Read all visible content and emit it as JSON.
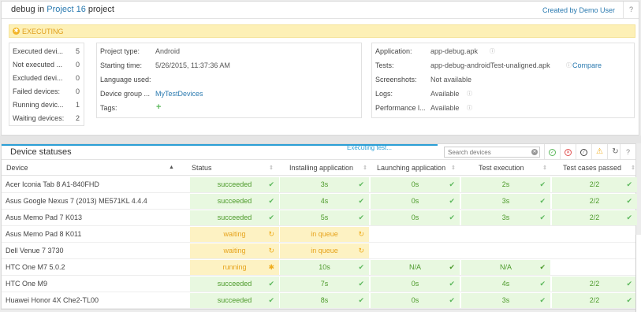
{
  "header": {
    "title_prefix": "debug",
    "title_in": "in",
    "project_link": "Project 16",
    "title_suffix": "project",
    "created_by": "Created by Demo User",
    "help": "?"
  },
  "status_banner": {
    "text": "EXECUTING",
    "color": "#fdf0b6"
  },
  "counts": [
    {
      "label": "Executed devi...",
      "value": "5"
    },
    {
      "label": "Not executed ...",
      "value": "0"
    },
    {
      "label": "Excluded devi...",
      "value": "0"
    },
    {
      "label": "Failed devices:",
      "value": "0"
    },
    {
      "label": "Running devic...",
      "value": "1"
    },
    {
      "label": "Waiting devices:",
      "value": "2"
    }
  ],
  "project_info": [
    {
      "label": "Project type:",
      "value": "Android"
    },
    {
      "label": "Starting time:",
      "value": "5/26/2015, 11:37:36 AM"
    },
    {
      "label": "Language used:",
      "value": ""
    },
    {
      "label": "Device group ...",
      "value": "MyTestDevices"
    },
    {
      "label": "Tags:",
      "value": "+"
    }
  ],
  "app_info": [
    {
      "label": "Application:",
      "value": "app-debug.apk",
      "extra": ""
    },
    {
      "label": "Tests:",
      "value": "app-debug-androidTest-unaligned.apk",
      "extra": "Compare"
    },
    {
      "label": "Screenshots:",
      "value": "Not available",
      "extra": ""
    },
    {
      "label": "Logs:",
      "value": "Available",
      "extra": ""
    },
    {
      "label": "Performance l...",
      "value": "Available",
      "extra": ""
    }
  ],
  "device_panel": {
    "title": "Device statuses",
    "progress": "Executing test...",
    "search_placeholder": "Search devices",
    "help": "?"
  },
  "columns": [
    "Device",
    "Status",
    "Installing application",
    "Launching application",
    "Test execution",
    "Test cases passed"
  ],
  "rows": [
    {
      "device": "Acer Iconia Tab 8 A1-840FHD",
      "status": "succeeded",
      "install": "3s",
      "launch": "0s",
      "exec": "2s",
      "passed": "2/2",
      "state": "ok"
    },
    {
      "device": "Asus Google Nexus 7 (2013) ME571KL 4.4.4",
      "status": "succeeded",
      "install": "4s",
      "launch": "0s",
      "exec": "3s",
      "passed": "2/2",
      "state": "ok"
    },
    {
      "device": "Asus Memo Pad 7 K013",
      "status": "succeeded",
      "install": "5s",
      "launch": "0s",
      "exec": "3s",
      "passed": "2/2",
      "state": "ok"
    },
    {
      "device": "Asus Memo Pad 8 K011",
      "status": "waiting",
      "install": "in queue",
      "launch": "",
      "exec": "",
      "passed": "",
      "state": "wait"
    },
    {
      "device": "Dell Venue 7 3730",
      "status": "waiting",
      "install": "in queue",
      "launch": "",
      "exec": "",
      "passed": "",
      "state": "wait"
    },
    {
      "device": "HTC One M7 5.0.2",
      "status": "running",
      "install": "10s",
      "launch": "N/A",
      "exec": "N/A",
      "passed": "",
      "state": "run"
    },
    {
      "device": "HTC One M9",
      "status": "succeeded",
      "install": "7s",
      "launch": "0s",
      "exec": "4s",
      "passed": "2/2",
      "state": "ok"
    },
    {
      "device": "Huawei Honor 4X Che2-TL00",
      "status": "succeeded",
      "install": "8s",
      "launch": "0s",
      "exec": "3s",
      "passed": "2/2",
      "state": "ok"
    }
  ]
}
